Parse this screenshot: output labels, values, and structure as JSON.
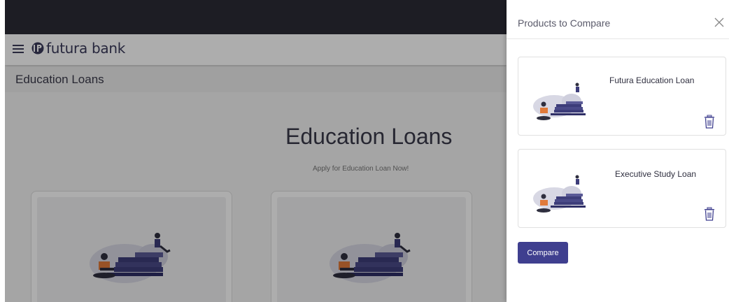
{
  "app": {
    "brand": "futura bank",
    "breadcrumb_title": "Education Loans",
    "page_title": "Education Loans",
    "page_subtitle": "Apply for Education Loan Now!"
  },
  "compare_panel": {
    "title": "Products to Compare",
    "products": [
      {
        "name": "Futura Education Loan"
      },
      {
        "name": "Executive Study Loan"
      }
    ],
    "compare_label": "Compare"
  },
  "colors": {
    "topbar": "#2b2b35",
    "accent": "#3f3f8f",
    "illustration_navy": "#3d3d7a"
  }
}
